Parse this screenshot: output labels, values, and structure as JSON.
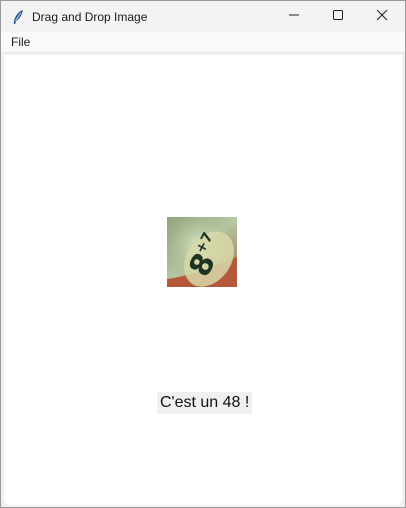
{
  "window": {
    "title": "Drag and Drop Image",
    "app_icon": "feather-icon",
    "controls": {
      "minimize_icon": "minimize-icon",
      "maximize_icon": "maximize-icon",
      "close_icon": "close-icon"
    }
  },
  "menu": {
    "items": [
      {
        "label": "File"
      }
    ]
  },
  "content": {
    "image": {
      "description_icon": "dropped-image-thumbnail"
    },
    "result_text": "C'est un 48 !"
  },
  "colors": {
    "content_bg": "#ffffff",
    "label_bg": "#f0f0f0",
    "titlebar_bg": "#f3f3f3"
  }
}
